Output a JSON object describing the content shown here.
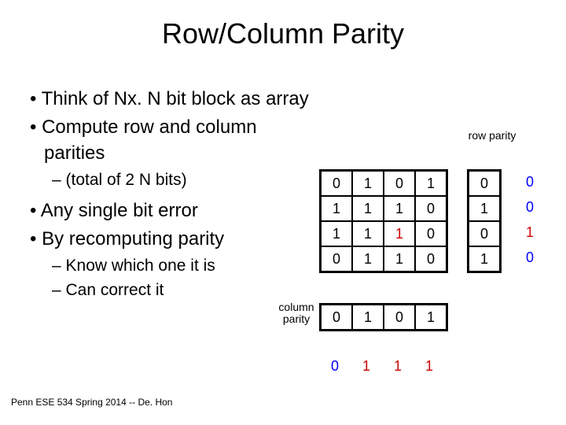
{
  "title": "Row/Column Parity",
  "bullets": {
    "b1": "Think of Nx. N bit block as array",
    "b2": "Compute row and column parities",
    "b1a": "(total of 2 N bits)",
    "b3": "Any single bit error",
    "b4": "By recomputing parity",
    "b4a": "Know which one it is",
    "b4b": "Can correct it"
  },
  "footer": "Penn ESE 534 Spring 2014 -- De. Hon",
  "labels": {
    "row_parity": "row parity",
    "col_parity": "column parity"
  },
  "chart_data": {
    "type": "table",
    "title": "4x4 bit block with row/column parities",
    "data_block": [
      [
        0,
        1,
        0,
        1
      ],
      [
        1,
        1,
        1,
        0
      ],
      [
        1,
        1,
        1,
        0
      ],
      [
        0,
        1,
        1,
        0
      ]
    ],
    "error_cell": {
      "row": 2,
      "col": 2
    },
    "row_parity": [
      0,
      1,
      0,
      1
    ],
    "row_syndrome": [
      0,
      0,
      1,
      0
    ],
    "col_parity": [
      0,
      1,
      0,
      1
    ],
    "col_syndrome": [
      0,
      1,
      1,
      1
    ],
    "colors": {
      "normal": "#000000",
      "error": "#cc0000",
      "syndrome": "#0000ff"
    }
  },
  "grid": {
    "r0c0": "0",
    "r0c1": "1",
    "r0c2": "0",
    "r0c3": "1",
    "r1c0": "1",
    "r1c1": "1",
    "r1c2": "1",
    "r1c3": "0",
    "r2c0": "1",
    "r2c1": "1",
    "r2c2": "1",
    "r2c3": "0",
    "r3c0": "0",
    "r3c1": "1",
    "r3c2": "1",
    "r3c3": "0",
    "rp0": "0",
    "rp1": "1",
    "rp2": "0",
    "rp3": "1",
    "cp0": "0",
    "cp1": "1",
    "cp2": "0",
    "cp3": "1",
    "sr0": "0",
    "sr1": "0",
    "sr2": "1",
    "sr3": "0",
    "sc0": "0",
    "sc1": "1",
    "sc2": "1",
    "sc3": "1"
  }
}
